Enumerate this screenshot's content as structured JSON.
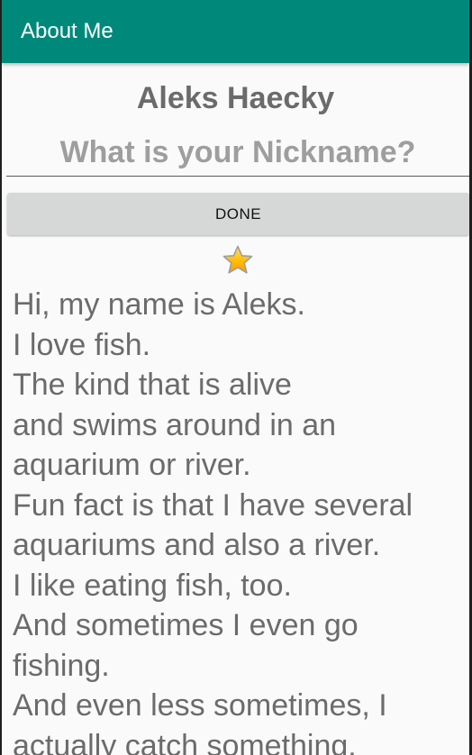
{
  "app_bar": {
    "title": "About Me",
    "color": "#00897b"
  },
  "main": {
    "name": "Aleks Haecky",
    "nickname_placeholder": "What is your Nickname?",
    "nickname_value": "",
    "done_label": "DONE",
    "star_icon": "yellow-star-icon",
    "bio": "Hi, my name is Aleks.\nI love fish.\nThe kind that is alive\nand swims around in an\naquarium or river.\nFun fact is that I have several\naquariums and also a river.\nI like eating fish, too.\nAnd sometimes I even go\nfishing.\nAnd even less sometimes, I\nactually catch something."
  },
  "colors": {
    "text_gray": "#6b6b6b",
    "button_gray": "#d6d7d7",
    "star_yellow": "#ffc107"
  }
}
